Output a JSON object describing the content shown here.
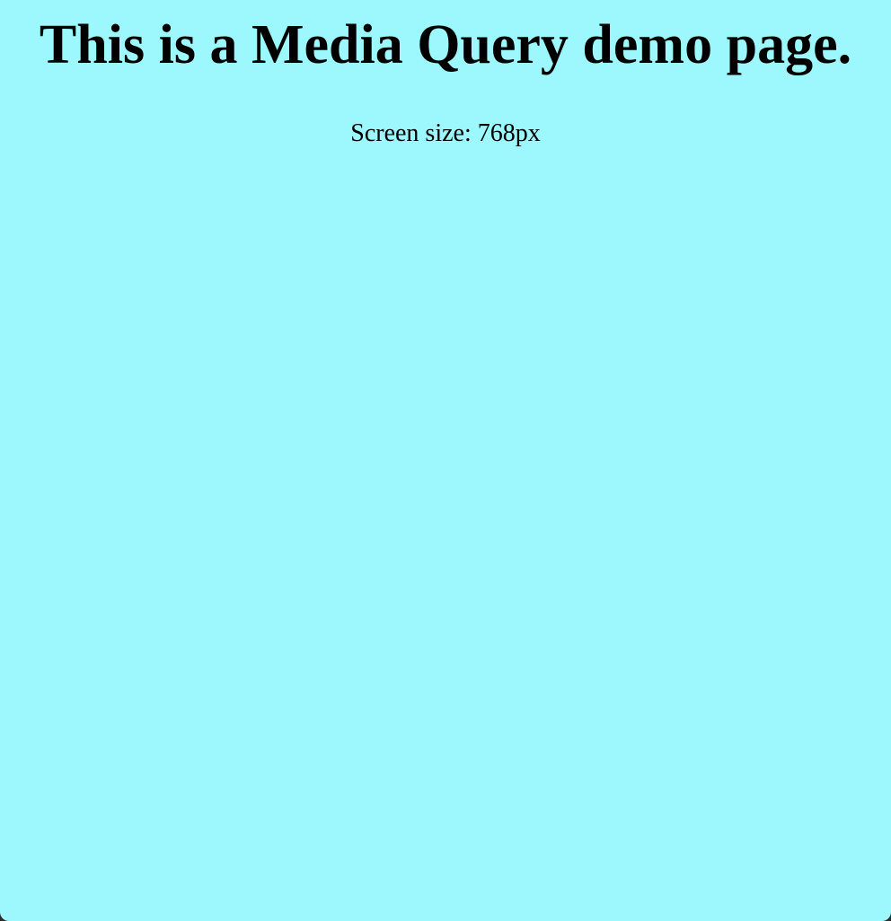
{
  "page": {
    "title": "This is a Media Query demo page.",
    "screen_size_text": "Screen size: 768px"
  },
  "colors": {
    "background": "#9cf8fc",
    "text": "#000000"
  }
}
